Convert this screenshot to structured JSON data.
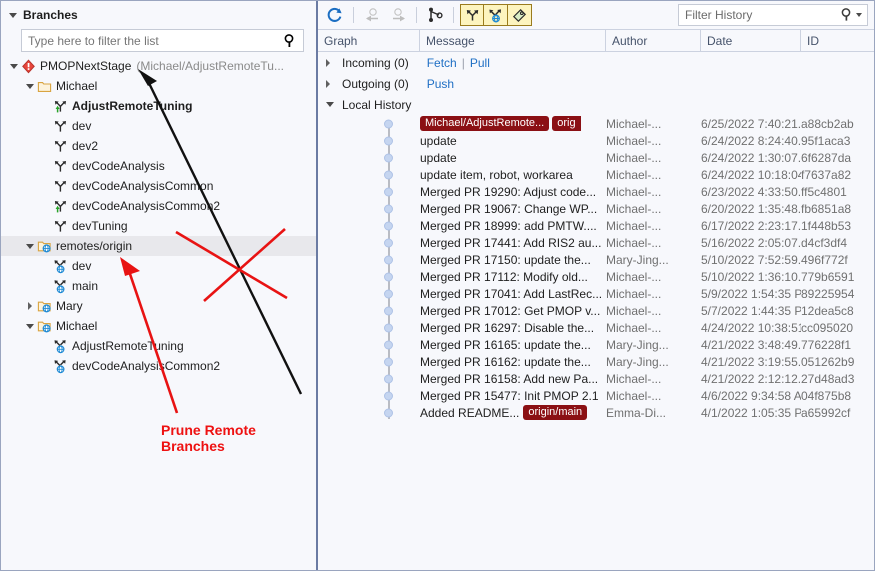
{
  "left_panel": {
    "header_title": "Branches",
    "filter_placeholder": "Type here to filter the list",
    "search_icon": "search-icon",
    "tree": [
      {
        "level": 0,
        "expander": "open",
        "icon": "repository-icon",
        "label": "PMOPNextStage",
        "sub": "(Michael/AdjustRemoteTu...",
        "bold": false,
        "selected": false
      },
      {
        "level": 1,
        "expander": "open",
        "icon": "folder-icon",
        "label": "Michael",
        "sub": "",
        "bold": false,
        "selected": false
      },
      {
        "level": 2,
        "expander": "none",
        "icon": "branch-current-icon",
        "label": "AdjustRemoteTuning",
        "sub": "",
        "bold": true,
        "selected": false
      },
      {
        "level": 2,
        "expander": "none",
        "icon": "branch-icon",
        "label": "dev",
        "sub": "",
        "bold": false,
        "selected": false
      },
      {
        "level": 2,
        "expander": "none",
        "icon": "branch-icon",
        "label": "dev2",
        "sub": "",
        "bold": false,
        "selected": false
      },
      {
        "level": 2,
        "expander": "none",
        "icon": "branch-icon",
        "label": "devCodeAnalysis",
        "sub": "",
        "bold": false,
        "selected": false
      },
      {
        "level": 2,
        "expander": "none",
        "icon": "branch-icon",
        "label": "devCodeAnalysisCommon",
        "sub": "",
        "bold": false,
        "selected": false
      },
      {
        "level": 2,
        "expander": "none",
        "icon": "branch-tracking-icon",
        "label": "devCodeAnalysisCommon2",
        "sub": "",
        "bold": false,
        "selected": false
      },
      {
        "level": 2,
        "expander": "none",
        "icon": "branch-icon",
        "label": "devTuning",
        "sub": "",
        "bold": false,
        "selected": false
      },
      {
        "level": 1,
        "expander": "open",
        "icon": "remote-folder-icon",
        "label": "remotes/origin",
        "sub": "",
        "bold": false,
        "selected": true
      },
      {
        "level": 2,
        "expander": "none",
        "icon": "remote-branch-icon",
        "label": "dev",
        "sub": "",
        "bold": false,
        "selected": false
      },
      {
        "level": 2,
        "expander": "none",
        "icon": "remote-branch-icon",
        "label": "main",
        "sub": "",
        "bold": false,
        "selected": false
      },
      {
        "level": 1,
        "expander": "closed",
        "icon": "remote-folder-icon",
        "label": "Mary",
        "sub": "",
        "bold": false,
        "selected": false
      },
      {
        "level": 1,
        "expander": "open",
        "icon": "remote-folder-icon",
        "label": "Michael",
        "sub": "",
        "bold": false,
        "selected": false
      },
      {
        "level": 2,
        "expander": "none",
        "icon": "remote-branch-icon",
        "label": "AdjustRemoteTuning",
        "sub": "",
        "bold": false,
        "selected": false
      },
      {
        "level": 2,
        "expander": "none",
        "icon": "remote-branch-icon",
        "label": "devCodeAnalysisCommon2",
        "sub": "",
        "bold": false,
        "selected": false
      }
    ]
  },
  "right_panel": {
    "toolbar": {
      "refresh_icon": "refresh-icon",
      "back_icon": "back-arrow-icon",
      "forward_icon": "forward-arrow-icon",
      "graph_icon": "commit-graph-icon",
      "toggle_local_branches_icon": "branch-icon",
      "toggle_remote_branches_icon": "remote-branch-icon",
      "toggle_tags_icon": "tag-icon",
      "filter_placeholder": "Filter History",
      "filter_search_icon": "search-icon",
      "filter_caret_icon": "chevron-down-icon"
    },
    "columns": [
      "Graph",
      "Message",
      "Author",
      "Date",
      "ID"
    ],
    "sections": [
      {
        "label": "Incoming (0)",
        "expander": "closed",
        "links": [
          "Fetch",
          "Pull"
        ]
      },
      {
        "label": "Outgoing (0)",
        "expander": "closed",
        "links": [
          "Push"
        ]
      },
      {
        "label": "Local History",
        "expander": "open",
        "links": []
      }
    ],
    "commits": [
      {
        "badges": [
          "Michael/AdjustRemote...",
          "orig"
        ],
        "message": "",
        "author": "Michael-...",
        "date": "6/25/2022 7:40:21...",
        "id": "a88cb2ab"
      },
      {
        "badges": [],
        "message": "update",
        "author": "Michael-...",
        "date": "6/24/2022 8:24:40...",
        "id": "95f1aca3"
      },
      {
        "badges": [],
        "message": "update",
        "author": "Michael-...",
        "date": "6/24/2022 1:30:07...",
        "id": "6f6287da"
      },
      {
        "badges": [],
        "message": "update item, robot, workarea",
        "author": "Michael-...",
        "date": "6/24/2022 10:18:04...",
        "id": "f7637a82"
      },
      {
        "badges": [],
        "message": "Merged PR 19290: Adjust code...",
        "author": "Michael-...",
        "date": "6/23/2022 4:33:50...",
        "id": "ff5c4801"
      },
      {
        "badges": [],
        "message": "Merged PR 19067: Change WP...",
        "author": "Michael-...",
        "date": "6/20/2022 1:35:48...",
        "id": "fb6851a8"
      },
      {
        "badges": [],
        "message": "Merged PR 18999: add PMTW....",
        "author": "Michael-...",
        "date": "6/17/2022 2:23:17...",
        "id": "1f448b53"
      },
      {
        "badges": [],
        "message": "Merged PR 17441: Add RIS2 au...",
        "author": "Michael-...",
        "date": "5/16/2022 2:05:07...",
        "id": "d4cf3df4"
      },
      {
        "badges": [],
        "message": "Merged PR 17150: update the...",
        "author": "Mary-Jing...",
        "date": "5/10/2022 7:52:59...",
        "id": "496f772f"
      },
      {
        "badges": [],
        "message": "Merged PR 17112: Modify old...",
        "author": "Michael-...",
        "date": "5/10/2022 1:36:10...",
        "id": "779b6591"
      },
      {
        "badges": [],
        "message": "Merged PR 17041: Add LastRec...",
        "author": "Michael-...",
        "date": "5/9/2022 1:54:35 PM",
        "id": "89225954"
      },
      {
        "badges": [],
        "message": "Merged PR 17012: Get PMOP v...",
        "author": "Michael-...",
        "date": "5/7/2022 1:44:35 PM",
        "id": "12dea5c8"
      },
      {
        "badges": [],
        "message": "Merged PR 16297: Disable the...",
        "author": "Michael-...",
        "date": "4/24/2022 10:38:51...",
        "id": "cc095020"
      },
      {
        "badges": [],
        "message": "Merged PR 16165: update the...",
        "author": "Mary-Jing...",
        "date": "4/21/2022 3:48:49...",
        "id": "776228f1"
      },
      {
        "badges": [],
        "message": "Merged PR 16162: update the...",
        "author": "Mary-Jing...",
        "date": "4/21/2022 3:19:55...",
        "id": "051262b9"
      },
      {
        "badges": [],
        "message": "Merged PR 16158: Add new Pa...",
        "author": "Michael-...",
        "date": "4/21/2022 2:12:12...",
        "id": "27d48ad3"
      },
      {
        "badges": [],
        "message": "Merged PR 15477: Init PMOP 2.1",
        "author": "Michael-...",
        "date": "4/6/2022 9:34:58 AM",
        "id": "04f875b8"
      },
      {
        "badges": [
          "origin/main"
        ],
        "message": "Added README...",
        "author": "Emma-Di...",
        "date": "4/1/2022 1:05:35 PM",
        "id": "a65992cf"
      }
    ]
  },
  "annotations": {
    "label": "Prune Remote Branches",
    "label_color": "#ee1111",
    "black_arrow": "black-arrow-pointing-to-repository",
    "red_arrow": "red-arrow-pointing-to-remotes-origin",
    "red_cross": "red-cross-mark-over-branch-list"
  }
}
